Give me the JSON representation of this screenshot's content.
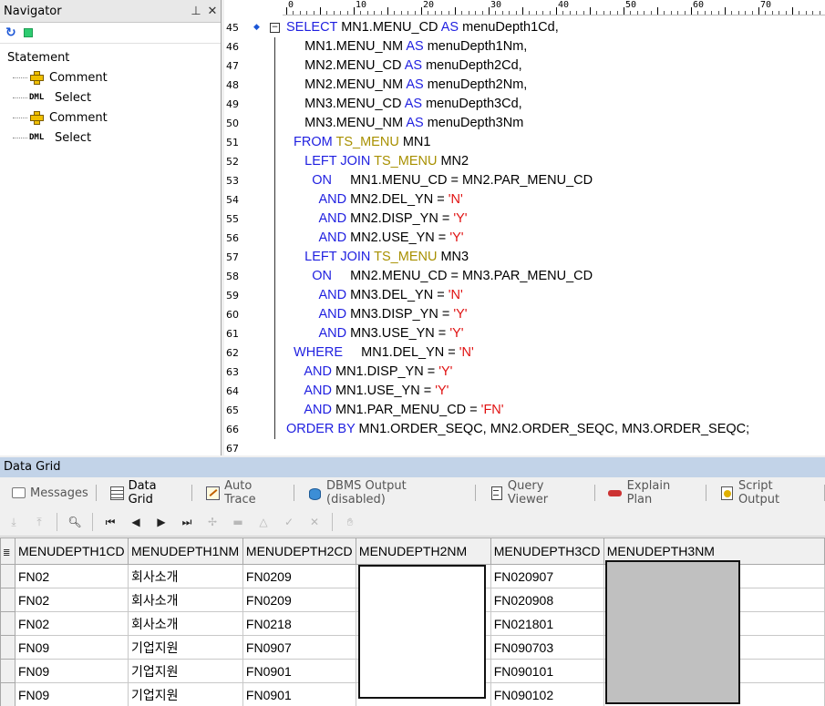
{
  "navigator": {
    "title": "Navigator",
    "pin_icon": "pin-icon",
    "close_icon": "close-icon",
    "root_label": "Statement",
    "items": [
      {
        "icon": "comment-plus-icon",
        "label": "Comment"
      },
      {
        "icon": "dml-icon",
        "icon_text": "DML",
        "label": "Select"
      },
      {
        "icon": "comment-plus-icon",
        "label": "Comment"
      },
      {
        "icon": "dml-icon",
        "icon_text": "DML",
        "label": "Select"
      }
    ]
  },
  "editor": {
    "ruler_numbers": [
      "0",
      "10",
      "20",
      "30",
      "40",
      "50",
      "60",
      "70"
    ],
    "lines": [
      {
        "n": "45",
        "segs": [
          [
            "kw",
            "SELECT "
          ],
          [
            "",
            "MN1.MENU_CD "
          ],
          [
            "kw",
            "AS"
          ],
          [
            "",
            " menuDepth1Cd,"
          ]
        ]
      },
      {
        "n": "46",
        "segs": [
          [
            "",
            "     MN1.MENU_NM "
          ],
          [
            "kw",
            "AS"
          ],
          [
            "",
            " menuDepth1Nm,"
          ]
        ]
      },
      {
        "n": "47",
        "segs": [
          [
            "",
            "     MN2.MENU_CD "
          ],
          [
            "kw",
            "AS"
          ],
          [
            "",
            " menuDepth2Cd,"
          ]
        ]
      },
      {
        "n": "48",
        "segs": [
          [
            "",
            "     MN2.MENU_NM "
          ],
          [
            "kw",
            "AS"
          ],
          [
            "",
            " menuDepth2Nm,"
          ]
        ]
      },
      {
        "n": "49",
        "segs": [
          [
            "",
            "     MN3.MENU_CD "
          ],
          [
            "kw",
            "AS"
          ],
          [
            "",
            " menuDepth3Cd,"
          ]
        ]
      },
      {
        "n": "50",
        "segs": [
          [
            "",
            "     MN3.MENU_NM "
          ],
          [
            "kw",
            "AS"
          ],
          [
            "",
            " menuDepth3Nm"
          ]
        ]
      },
      {
        "n": "51",
        "segs": [
          [
            "kw",
            "  FROM "
          ],
          [
            "tb",
            "TS_MENU"
          ],
          [
            "",
            " MN1"
          ]
        ]
      },
      {
        "n": "52",
        "segs": [
          [
            "kw",
            "     LEFT JOIN "
          ],
          [
            "tb",
            "TS_MENU"
          ],
          [
            "",
            " MN2"
          ]
        ]
      },
      {
        "n": "53",
        "segs": [
          [
            "kw",
            "       ON"
          ],
          [
            "",
            "     MN1.MENU_CD = MN2.PAR_MENU_CD"
          ]
        ]
      },
      {
        "n": "54",
        "segs": [
          [
            "kw",
            "         AND "
          ],
          [
            "",
            "MN2.DEL_YN = "
          ],
          [
            "st",
            "'N'"
          ]
        ]
      },
      {
        "n": "55",
        "segs": [
          [
            "kw",
            "         AND "
          ],
          [
            "",
            "MN2.DISP_YN = "
          ],
          [
            "st",
            "'Y'"
          ]
        ]
      },
      {
        "n": "56",
        "segs": [
          [
            "kw",
            "         AND "
          ],
          [
            "",
            "MN2.USE_YN = "
          ],
          [
            "st",
            "'Y'"
          ]
        ]
      },
      {
        "n": "57",
        "segs": [
          [
            "kw",
            "     LEFT JOIN "
          ],
          [
            "tb",
            "TS_MENU"
          ],
          [
            "",
            " MN3"
          ]
        ]
      },
      {
        "n": "58",
        "segs": [
          [
            "kw",
            "       ON"
          ],
          [
            "",
            "     MN2.MENU_CD = MN3.PAR_MENU_CD"
          ]
        ]
      },
      {
        "n": "59",
        "segs": [
          [
            "kw",
            "         AND "
          ],
          [
            "",
            "MN3.DEL_YN = "
          ],
          [
            "st",
            "'N'"
          ]
        ]
      },
      {
        "n": "60",
        "segs": [
          [
            "kw",
            "         AND "
          ],
          [
            "",
            "MN3.DISP_YN = "
          ],
          [
            "st",
            "'Y'"
          ]
        ]
      },
      {
        "n": "61",
        "segs": [
          [
            "kw",
            "         AND "
          ],
          [
            "",
            "MN3.USE_YN = "
          ],
          [
            "st",
            "'Y'"
          ]
        ]
      },
      {
        "n": "62",
        "segs": [
          [
            "kw",
            "  WHERE"
          ],
          [
            "",
            "     MN1.DEL_YN = "
          ],
          [
            "st",
            "'N'"
          ]
        ]
      },
      {
        "n": "63",
        "segs": [
          [
            "kw",
            "     AND "
          ],
          [
            "",
            "MN1.DISP_YN = "
          ],
          [
            "st",
            "'Y'"
          ]
        ]
      },
      {
        "n": "64",
        "segs": [
          [
            "kw",
            "     AND "
          ],
          [
            "",
            "MN1.USE_YN = "
          ],
          [
            "st",
            "'Y'"
          ]
        ]
      },
      {
        "n": "65",
        "segs": [
          [
            "kw",
            "     AND "
          ],
          [
            "",
            "MN1.PAR_MENU_CD = "
          ],
          [
            "st",
            "'FN'"
          ]
        ]
      },
      {
        "n": "66",
        "segs": [
          [
            "kw",
            "ORDER BY "
          ],
          [
            "",
            "MN1.ORDER_SEQC, MN2.ORDER_SEQC, MN3.ORDER_SEQC;"
          ]
        ]
      },
      {
        "n": "67",
        "segs": []
      }
    ]
  },
  "data_grid": {
    "panel_title": "Data Grid",
    "tabs": [
      {
        "label": "Messages",
        "icon": "messages-icon",
        "active": false
      },
      {
        "label": "Data Grid",
        "icon": "grid-icon",
        "active": true
      },
      {
        "label": "Auto Trace",
        "icon": "trace-icon",
        "active": false
      },
      {
        "label": "DBMS Output (disabled)",
        "icon": "dbms-icon",
        "active": false
      },
      {
        "label": "Query Viewer",
        "icon": "query-viewer-icon",
        "active": false
      },
      {
        "label": "Explain Plan",
        "icon": "explain-plan-icon",
        "active": false
      },
      {
        "label": "Script Output",
        "icon": "script-output-icon",
        "active": false
      }
    ],
    "columns": [
      "MENUDEPTH1CD",
      "MENUDEPTH1NM",
      "MENUDEPTH2CD",
      "MENUDEPTH2NM",
      "MENUDEPTH3CD",
      "MENUDEPTH3NM"
    ],
    "rows": [
      [
        "FN02",
        "회사소개",
        "FN0209",
        "",
        "FN020907",
        ""
      ],
      [
        "FN02",
        "회사소개",
        "FN0209",
        "",
        "FN020908",
        ""
      ],
      [
        "FN02",
        "회사소개",
        "FN0218",
        "",
        "FN021801",
        ""
      ],
      [
        "FN09",
        "기업지원",
        "FN0907",
        "",
        "FN090703",
        ""
      ],
      [
        "FN09",
        "기업지원",
        "FN0901",
        "",
        "FN090101",
        ""
      ],
      [
        "FN09",
        "기업지원",
        "FN0901",
        "",
        "FN090102",
        ""
      ]
    ]
  }
}
